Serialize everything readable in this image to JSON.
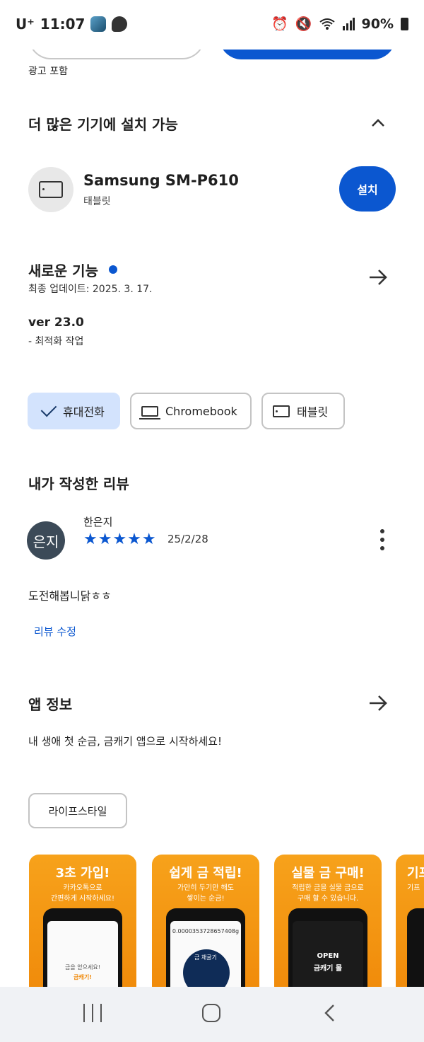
{
  "status_bar": {
    "carrier": "U⁺",
    "time": "11:07",
    "battery": "90%"
  },
  "ad_label": "광고 포함",
  "more_devices": {
    "title": "더 많은 기기에 설치 가능",
    "device_name": "Samsung SM-P610",
    "device_type": "태블릿",
    "install_label": "설치"
  },
  "whats_new": {
    "title": "새로운 기능",
    "updated": "최종 업데이트: 2025. 3. 17.",
    "version": "ver 23.0",
    "note": "- 최적화 작업"
  },
  "device_chips": [
    {
      "label": "휴대전화"
    },
    {
      "label": "Chromebook"
    },
    {
      "label": "태블릿"
    }
  ],
  "my_review": {
    "title": "내가 작성한 리뷰",
    "avatar_text": "은지",
    "reviewer": "한은지",
    "stars": "★★★★★",
    "rating": 5,
    "date": "25/2/28",
    "text": "도전해봅니닭ㅎㅎ",
    "edit_label": "리뷰 수정"
  },
  "app_info": {
    "title": "앱 정보",
    "description": "내 생애 첫 순금, 금캐기 앱으로 시작하세요!",
    "category": "라이프스타일"
  },
  "screenshots": [
    {
      "title": "3초 가입!",
      "sub": "카카오톡으로\n간편하게 시작하세요!",
      "screen_top": "금을 얻으세요!",
      "screen_bottom": "금캐기!"
    },
    {
      "title": "쉽게 금 적립!",
      "sub": "가만히 두기만 해도\n쌓이는 순금!",
      "screen_top": "0.0000353728657408g",
      "screen_bottom": "금 채굴기"
    },
    {
      "title": "실물 금 구매!",
      "sub": "적립한 금을 실물 금으로\n구매 할 수 있습니다.",
      "screen_top": "OPEN",
      "screen_bottom": "금캐기 몰"
    },
    {
      "title": "기프",
      "sub": "기프",
      "screen_top": "",
      "screen_bottom": ""
    }
  ],
  "colors": {
    "accent": "#0b57d0",
    "chip_active": "#d3e3fd",
    "screenshot_bg": "#f39a14"
  },
  "icons": [
    "chevron-up-icon",
    "arrow-right-icon",
    "tablet-icon",
    "laptop-icon",
    "check-icon",
    "more-vert-icon"
  ]
}
